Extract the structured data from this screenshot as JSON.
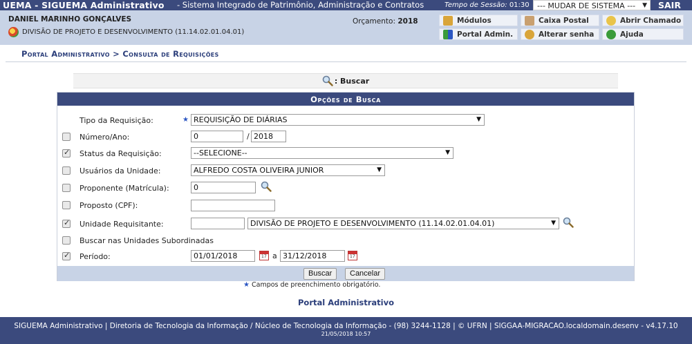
{
  "topbar": {
    "system_name": "UEMA - SIGUEMA Administrativo",
    "subtitle": "- Sistema Integrado de Patrimônio, Administração e Contratos",
    "session_label": "Tempo de Sessão:",
    "session_time": "01:30",
    "system_switch": "--- MUDAR DE SISTEMA ---",
    "logout": "SAIR"
  },
  "user": {
    "name": "DANIEL MARINHO GONÇALVES",
    "unit": "DIVISÃO DE PROJETO E DESENVOLVIMENTO (11.14.02.01.04.01)",
    "budget_label": "Orçamento:",
    "budget_year": "2018"
  },
  "quick_links": {
    "modules": "Módulos",
    "mailbox": "Caixa Postal",
    "open_ticket": "Abrir Chamado",
    "admin_portal": "Portal Admin.",
    "change_password": "Alterar senha",
    "help": "Ajuda"
  },
  "breadcrumb": "Portal Administrativo > Consulta de Requisições",
  "search_header": ": Buscar",
  "panel_title": "Opções de Busca",
  "form": {
    "tipo": {
      "label": "Tipo da Requisição:",
      "value": "REQUISIÇÃO DE DIÁRIAS"
    },
    "numero": {
      "label": "Número/Ano:",
      "number": "0",
      "year": "2018"
    },
    "status": {
      "label": "Status da Requisição:",
      "value": "--SELECIONE--"
    },
    "usuarios": {
      "label": "Usuários da Unidade:",
      "value": "ALFREDO COSTA OLIVEIRA JUNIOR"
    },
    "proponente": {
      "label": "Proponente (Matrícula):",
      "value": "0"
    },
    "proposto": {
      "label": "Proposto (CPF):",
      "value": ""
    },
    "unidade": {
      "label": "Unidade Requisitante:",
      "code": "",
      "value": "DIVISÃO DE PROJETO E DESENVOLVIMENTO (11.14.02.01.04.01)"
    },
    "subordinadas": {
      "label": "Buscar nas Unidades Subordinadas"
    },
    "periodo": {
      "label": "Período:",
      "start": "01/01/2018",
      "sep": "a",
      "end": "31/12/2018"
    },
    "checks": {
      "numero": false,
      "status": true,
      "usuarios": false,
      "proponente": false,
      "proposto": false,
      "unidade": true,
      "subordinadas": false,
      "periodo": true
    },
    "required_star": "★"
  },
  "buttons": {
    "search": "Buscar",
    "cancel": "Cancelar"
  },
  "required_note": "Campos de preenchimento obrigatório.",
  "portal_link": "Portal Administrativo",
  "footer": {
    "line1": "SIGUEMA Administrativo | Diretoria de Tecnologia da Informação / Núcleo de Tecnologia da Informação - (98) 3244-1128 | © UFRN | SIGGAA-MIGRACAO.localdomain.desenv - v4.17.10",
    "line2": "21/05/2018 10:57"
  },
  "colors": {
    "header_navy": "#3b4a7d",
    "light_blue": "#c8d3e6",
    "link_blue": "#2b3e7a",
    "required_star": "#2b56c2"
  }
}
